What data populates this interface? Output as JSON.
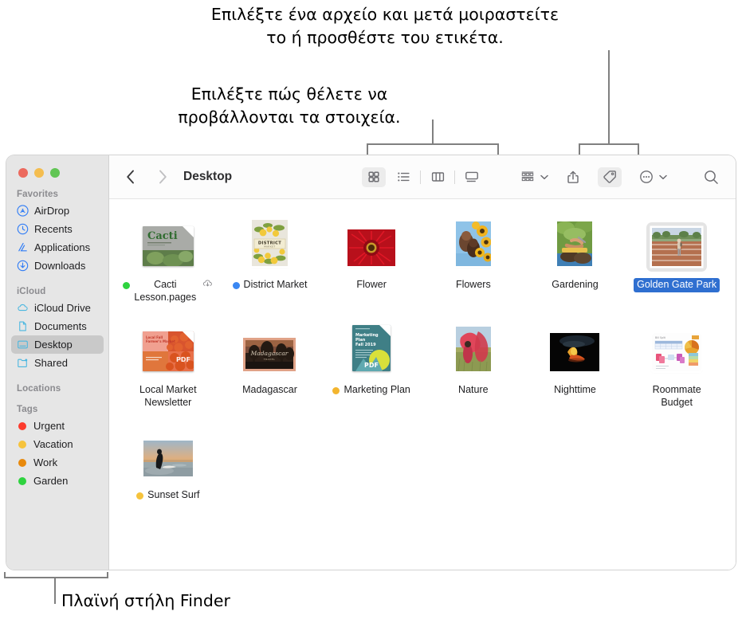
{
  "annotations": {
    "share_tag": "Επιλέξτε ένα αρχείο και μετά μοιραστείτε\nτο ή προσθέστε του ετικέτα.",
    "view_options": "Επιλέξτε πώς θέλετε να\nπροβάλλονται τα στοιχεία.",
    "sidebar": "Πλαϊνή στήλη Finder"
  },
  "window": {
    "traffic_lights": {
      "close": "close-button",
      "minimize": "minimize-button",
      "maximize": "maximize-button",
      "close_color": "#ec6a5e",
      "minimize_color": "#f4bd4f",
      "maximize_color": "#61c554"
    }
  },
  "toolbar": {
    "back_label": "Back",
    "forward_label": "Forward",
    "path_title": "Desktop",
    "views": [
      {
        "name": "icon-view",
        "label": "Icon View",
        "active": true
      },
      {
        "name": "list-view",
        "label": "List View",
        "active": false
      },
      {
        "name": "column-view",
        "label": "Column View",
        "active": false
      },
      {
        "name": "gallery-view",
        "label": "Gallery View",
        "active": false
      }
    ],
    "group_label": "Group",
    "share_label": "Share",
    "tag_label": "Tags",
    "more_label": "More",
    "search_label": "Search"
  },
  "sidebar": {
    "sections": [
      {
        "title": "Favorites",
        "items": [
          {
            "label": "AirDrop",
            "icon": "airdrop-icon",
            "selected": false
          },
          {
            "label": "Recents",
            "icon": "clock-icon",
            "selected": false
          },
          {
            "label": "Applications",
            "icon": "applications-icon",
            "selected": false
          },
          {
            "label": "Downloads",
            "icon": "download-icon",
            "selected": false
          }
        ]
      },
      {
        "title": "iCloud",
        "items": [
          {
            "label": "iCloud Drive",
            "icon": "cloud-icon",
            "selected": false
          },
          {
            "label": "Documents",
            "icon": "document-icon",
            "selected": false
          },
          {
            "label": "Desktop",
            "icon": "desktop-icon",
            "selected": true
          },
          {
            "label": "Shared",
            "icon": "shared-folder-icon",
            "selected": false
          }
        ]
      },
      {
        "title": "Locations",
        "items": []
      },
      {
        "title": "Tags",
        "items": [
          {
            "label": "Urgent",
            "icon": "tag-dot",
            "color": "#fc3b2d",
            "selected": false
          },
          {
            "label": "Vacation",
            "icon": "tag-dot",
            "color": "#f6c33c",
            "selected": false
          },
          {
            "label": "Work",
            "icon": "tag-dot",
            "color": "#e8890c",
            "selected": false
          },
          {
            "label": "Garden",
            "icon": "tag-dot",
            "color": "#2ed33f",
            "selected": false
          }
        ]
      }
    ]
  },
  "files": [
    {
      "name": "Cacti\nLesson.pages",
      "tag": "#2ed33f",
      "selected": false,
      "cloud": true,
      "kind": "pages-doc"
    },
    {
      "name": "District Market",
      "tag": "#3a87f2",
      "selected": false,
      "cloud": false,
      "kind": "photo-market"
    },
    {
      "name": "Flower",
      "tag": null,
      "selected": false,
      "cloud": false,
      "kind": "photo-flower"
    },
    {
      "name": "Flowers",
      "tag": null,
      "selected": false,
      "cloud": false,
      "kind": "photo-flowers"
    },
    {
      "name": "Gardening",
      "tag": null,
      "selected": false,
      "cloud": false,
      "kind": "photo-gardening"
    },
    {
      "name": "Golden Gate Park",
      "tag": null,
      "selected": true,
      "cloud": false,
      "kind": "photo-park"
    },
    {
      "name": "Local Market\nNewsletter",
      "tag": null,
      "selected": false,
      "cloud": false,
      "kind": "pdf-newsletter"
    },
    {
      "name": "Madagascar",
      "tag": null,
      "selected": false,
      "cloud": false,
      "kind": "photo-madagascar"
    },
    {
      "name": "Marketing Plan",
      "tag": "#f3b52e",
      "selected": false,
      "cloud": false,
      "kind": "pdf-marketing"
    },
    {
      "name": "Nature",
      "tag": null,
      "selected": false,
      "cloud": false,
      "kind": "photo-nature"
    },
    {
      "name": "Nighttime",
      "tag": null,
      "selected": false,
      "cloud": false,
      "kind": "photo-nighttime"
    },
    {
      "name": "Roommate\nBudget",
      "tag": null,
      "selected": false,
      "cloud": false,
      "kind": "numbers-doc"
    },
    {
      "name": "Sunset Surf",
      "tag": "#f6c33c",
      "selected": false,
      "cloud": false,
      "kind": "photo-sunset"
    }
  ]
}
